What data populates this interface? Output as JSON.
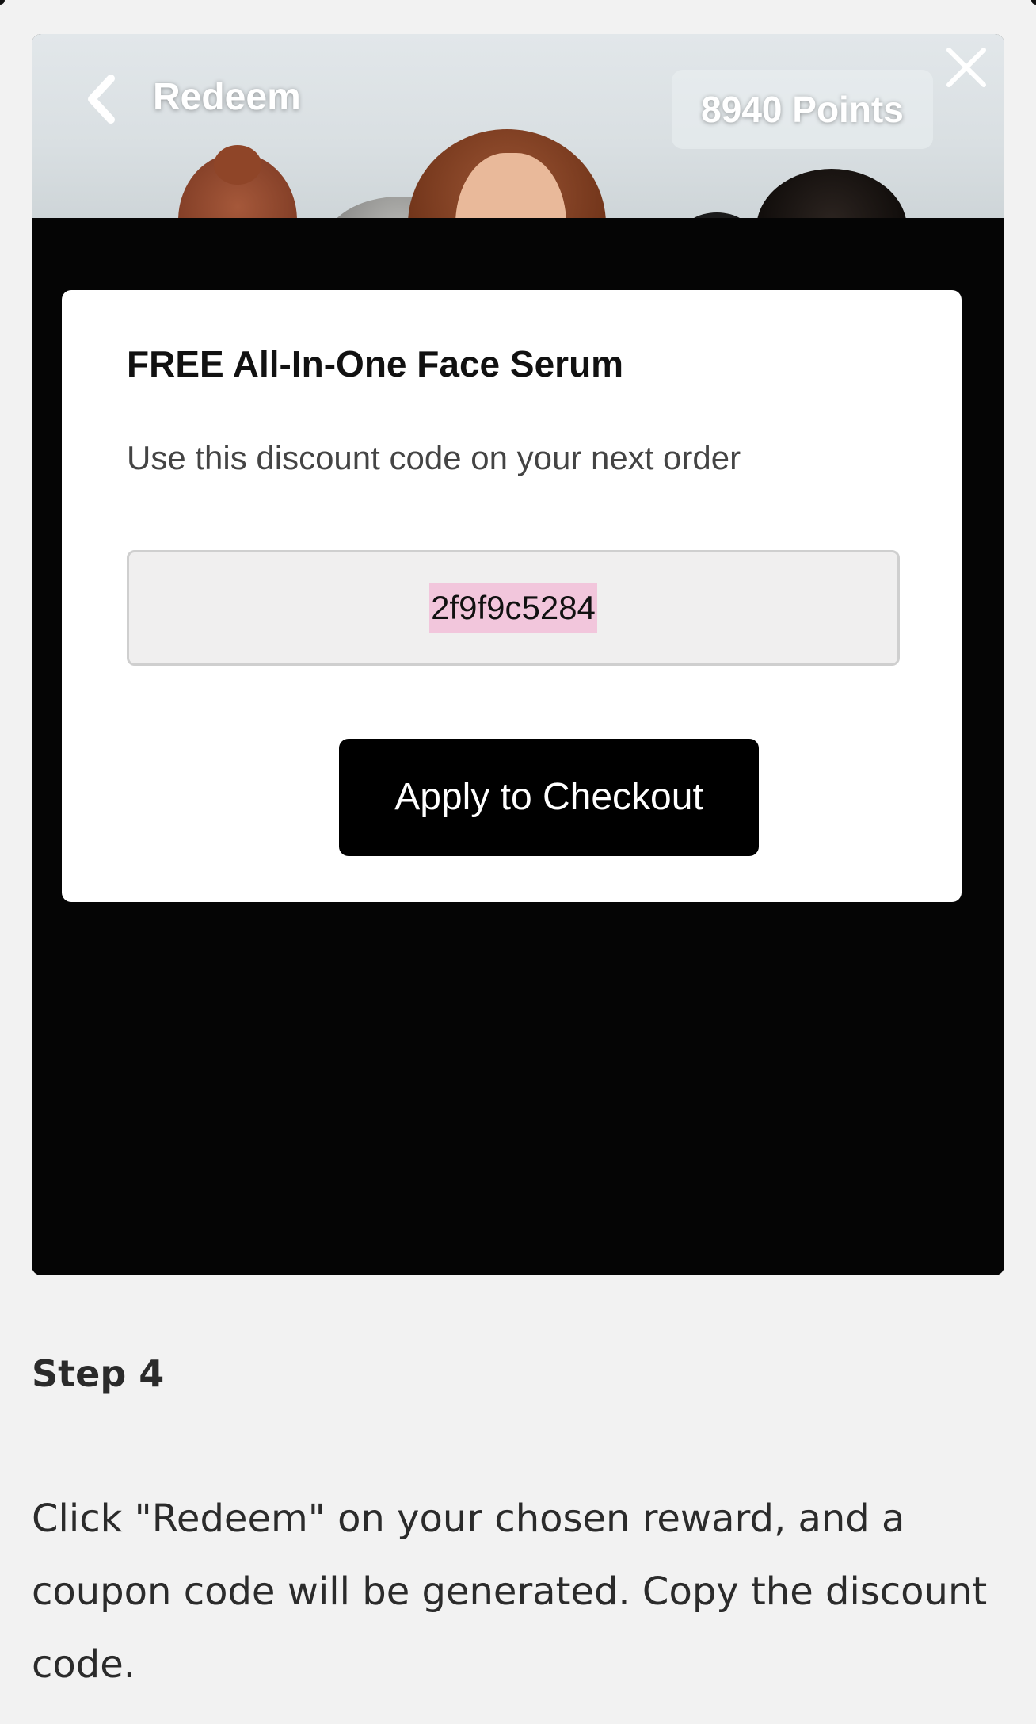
{
  "header": {
    "title": "Redeem",
    "points": "8940 Points"
  },
  "card": {
    "title": "FREE All-In-One Face Serum",
    "subtitle": "Use this discount code on your next order",
    "code": "2f9f9c5284",
    "button_label": "Apply to Checkout"
  },
  "step": {
    "title": "Step 4",
    "description": "Click \"Redeem\" on your chosen reward, and a coupon code will be generated. Copy the discount code."
  },
  "icons": {
    "back": "chevron-left-icon",
    "close": "close-icon"
  },
  "colors": {
    "page_background": "#f2f2f2",
    "panel_background": "#050505",
    "button_background": "#000000",
    "code_highlight": "#f2c6dc"
  }
}
